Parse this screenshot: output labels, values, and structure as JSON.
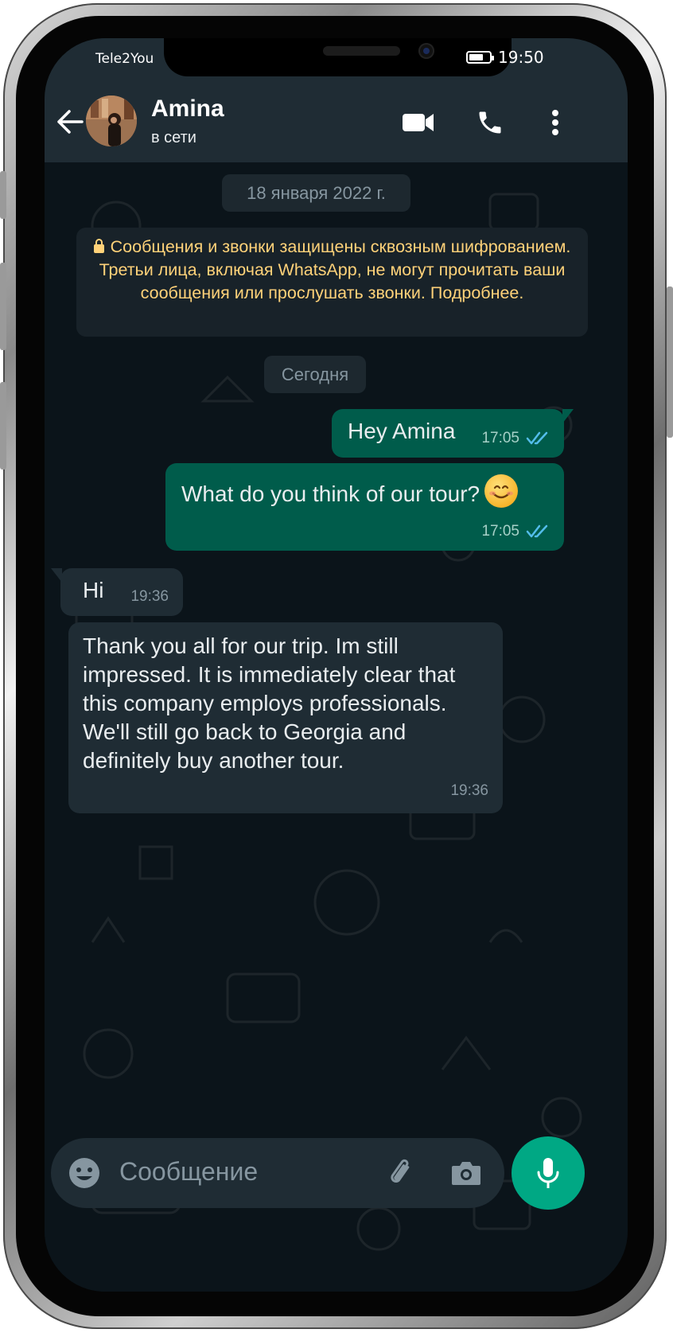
{
  "status_bar": {
    "carrier": "Tele2You",
    "time": "19:50",
    "battery_level": 0.7
  },
  "header": {
    "contact_name": "Amina",
    "contact_status": "в сети",
    "icons": [
      "back-arrow-icon",
      "video-call-icon",
      "phone-call-icon",
      "more-vert-icon"
    ]
  },
  "chat": {
    "date_pill": "18 января 2022 г.",
    "encryption_notice": "Сообщения и звонки защищены сквозным шифрованием. Третьи лица, включая WhatsApp, не могут прочитать ваши сообщения или прослушать звонки. Подробнее.",
    "today_pill": "Сегодня",
    "messages": [
      {
        "direction": "out",
        "text": "Hey Amina",
        "time": "17:05",
        "status": "read"
      },
      {
        "direction": "out",
        "text": "What do you think of our tour?",
        "emoji": "smiling-face-emoji",
        "time": "17:05",
        "status": "read"
      },
      {
        "direction": "in",
        "text": "Hi",
        "time": "19:36"
      },
      {
        "direction": "in",
        "text": "Thank you all for our trip. Im still impressed. It is immediately clear that this company employs professionals. We'll still go back to Georgia and definitely buy another tour.",
        "time": "19:36"
      }
    ]
  },
  "input": {
    "placeholder": "Сообщение",
    "icons": [
      "emoji-icon",
      "attach-icon",
      "camera-icon",
      "mic-icon"
    ]
  },
  "colors": {
    "header_bg": "#1f2c34",
    "chat_bg": "#0b141a",
    "outgoing_bubble": "#005c4b",
    "incoming_bubble": "#1f2c34",
    "accent": "#00a884",
    "read_ticks": "#53bdeb",
    "notice_text": "#ffd279"
  }
}
